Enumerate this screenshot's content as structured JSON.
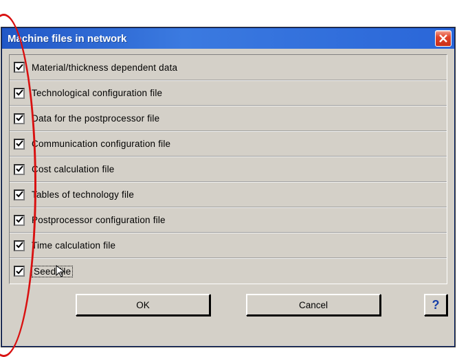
{
  "dialog": {
    "title": "Machine files in network"
  },
  "items": [
    {
      "label": "Material/thickness dependent data",
      "checked": true
    },
    {
      "label": "Technological configuration file",
      "checked": true
    },
    {
      "label": "Data for the postprocessor file",
      "checked": true
    },
    {
      "label": "Communication configuration file",
      "checked": true
    },
    {
      "label": "Cost calculation file",
      "checked": true
    },
    {
      "label": "Tables of technology file",
      "checked": true
    },
    {
      "label": "Postprocessor configuration file",
      "checked": true
    },
    {
      "label": "Time calculation file",
      "checked": true
    },
    {
      "label": "Seed file",
      "checked": true
    }
  ],
  "buttons": {
    "ok": "OK",
    "cancel": "Cancel",
    "help": "?"
  }
}
